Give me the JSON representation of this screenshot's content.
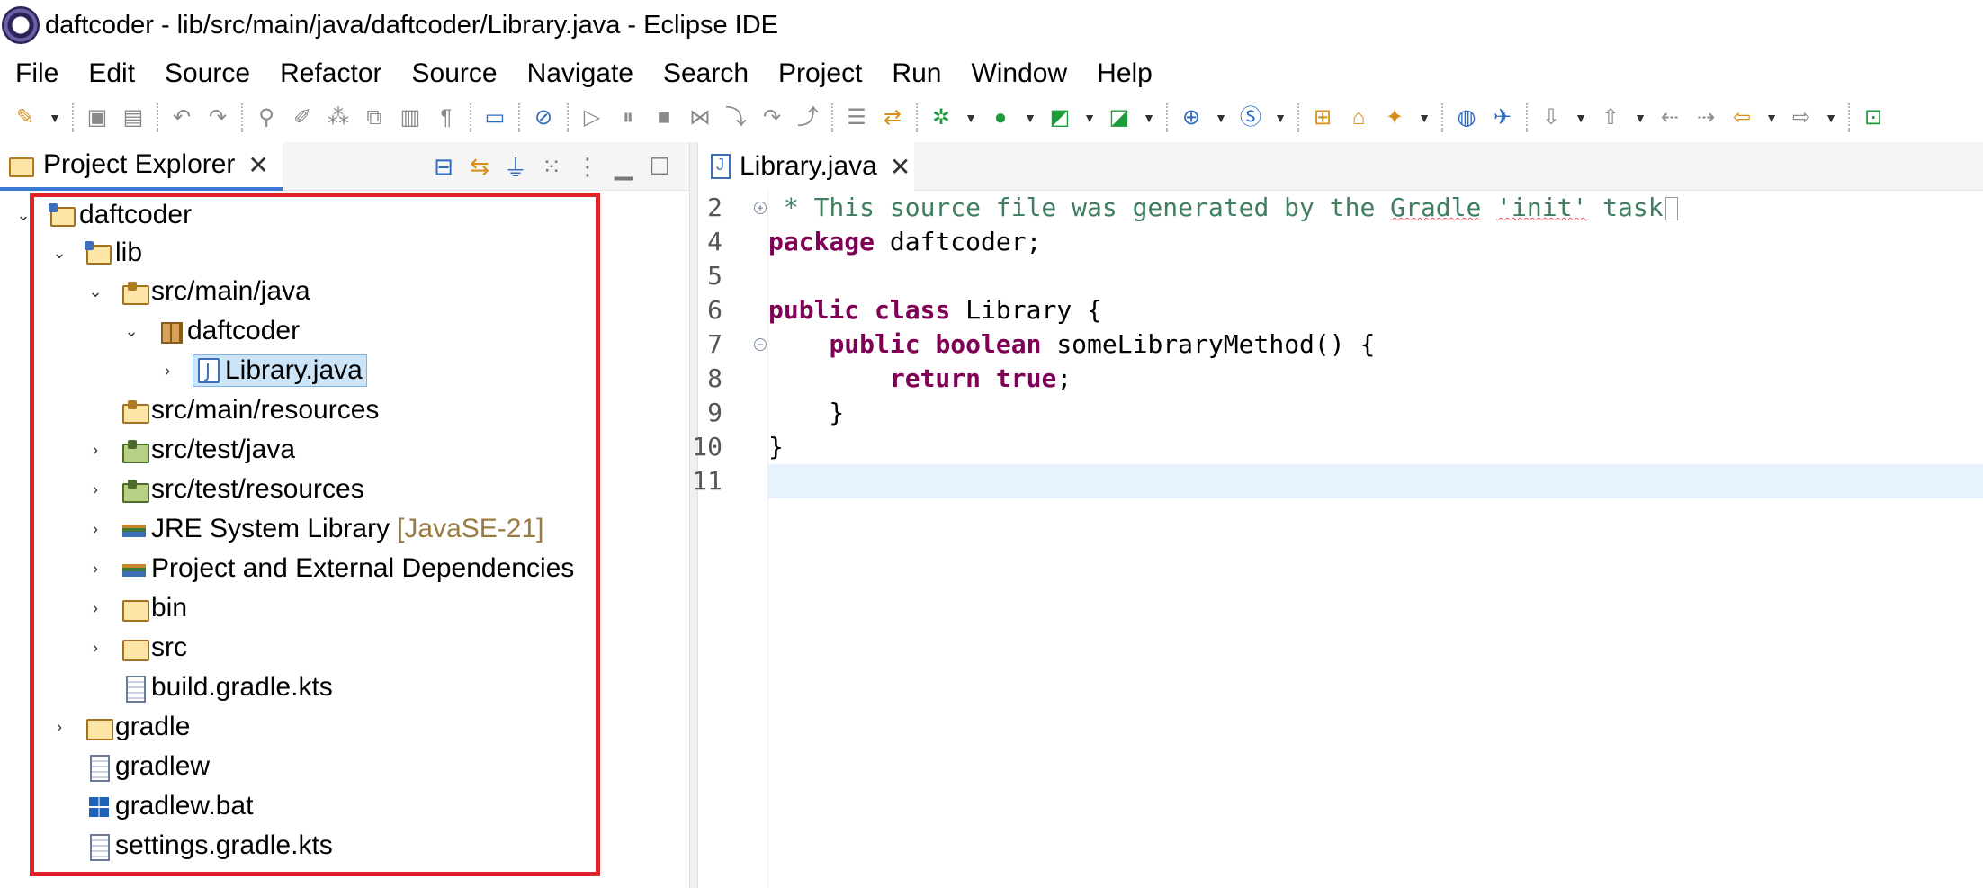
{
  "window": {
    "title": "daftcoder - lib/src/main/java/daftcoder/Library.java - Eclipse IDE"
  },
  "menu": [
    "File",
    "Edit",
    "Source",
    "Refactor",
    "Source",
    "Navigate",
    "Search",
    "Project",
    "Run",
    "Window",
    "Help"
  ],
  "explorer": {
    "tab_label": "Project Explorer",
    "tab_close": "✕",
    "tree": [
      {
        "label": "daftcoder",
        "icon": "project-icon",
        "expanded": true
      },
      {
        "label": "lib",
        "icon": "project-icon",
        "expanded": true
      },
      {
        "label": "src/main/java",
        "icon": "source-folder-icon",
        "expanded": true
      },
      {
        "label": "daftcoder",
        "icon": "package-icon",
        "expanded": true
      },
      {
        "label": "Library.java",
        "icon": "java-file-icon",
        "expanded": false,
        "selected": true
      },
      {
        "label": "src/main/resources",
        "icon": "source-folder-icon"
      },
      {
        "label": "src/test/java",
        "icon": "test-folder-icon",
        "expanded": false
      },
      {
        "label": "src/test/resources",
        "icon": "test-folder-icon",
        "expanded": false
      },
      {
        "label": "JRE System Library",
        "suffix": "[JavaSE-21]",
        "icon": "library-icon",
        "expanded": false
      },
      {
        "label": "Project and External Dependencies",
        "icon": "library-icon",
        "expanded": false
      },
      {
        "label": "bin",
        "icon": "folder-icon",
        "expanded": false
      },
      {
        "label": "src",
        "icon": "folder-icon",
        "expanded": false
      },
      {
        "label": "build.gradle.kts",
        "icon": "file-icon"
      },
      {
        "label": "gradle",
        "icon": "folder-icon",
        "expanded": false
      },
      {
        "label": "gradlew",
        "icon": "file-icon"
      },
      {
        "label": "gradlew.bat",
        "icon": "bat-file-icon"
      },
      {
        "label": "settings.gradle.kts",
        "icon": "file-icon"
      }
    ]
  },
  "editor": {
    "tab_label": "Library.java",
    "tab_close": "✕",
    "line_numbers": [
      "2",
      "4",
      "5",
      "6",
      "7",
      "8",
      "9",
      "10",
      "11"
    ],
    "code": {
      "l2_comment": " * This source file was generated by the ",
      "l2_gradle": "Gradle",
      "l2_sp": " ",
      "l2_init": "'init'",
      "l2_task": " task",
      "l4_kw": "package",
      "l4_rest": " daftcoder;",
      "l6_kw1": "public",
      "l6_sp": " ",
      "l6_kw2": "class",
      "l6_rest": " Library {",
      "l7_indent": "    ",
      "l7_kw1": "public",
      "l7_sp": " ",
      "l7_kw2": "boolean",
      "l7_rest": " someLibraryMethod() {",
      "l8_indent": "        ",
      "l8_kw1": "return",
      "l8_sp": " ",
      "l8_kw2": "true",
      "l8_rest": ";",
      "l9": "    }",
      "l10": "}"
    }
  },
  "colors": {
    "selection_border": "#e0222b",
    "keyword": "#7f0055",
    "comment": "#3f7f5f",
    "current_line": "#e8f2fe"
  }
}
